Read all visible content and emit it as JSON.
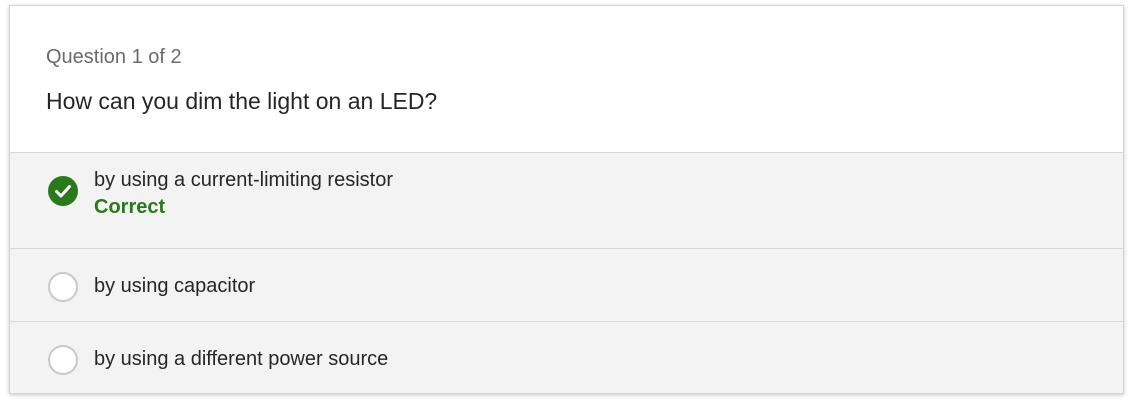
{
  "quiz": {
    "counter": "Question 1 of 2",
    "question": "How can you dim the light on an LED?",
    "options": [
      {
        "label": "by using a current-limiting resistor",
        "selected": true,
        "feedback": "Correct"
      },
      {
        "label": "by using capacitor",
        "selected": false
      },
      {
        "label": "by using a different power source",
        "selected": false
      }
    ]
  },
  "colors": {
    "correct": "#2a7a1b",
    "option_background": "#f3f3f3"
  },
  "icons": {
    "selected_option": "check-circle-icon",
    "unselected_option": "radio-circle-icon"
  }
}
